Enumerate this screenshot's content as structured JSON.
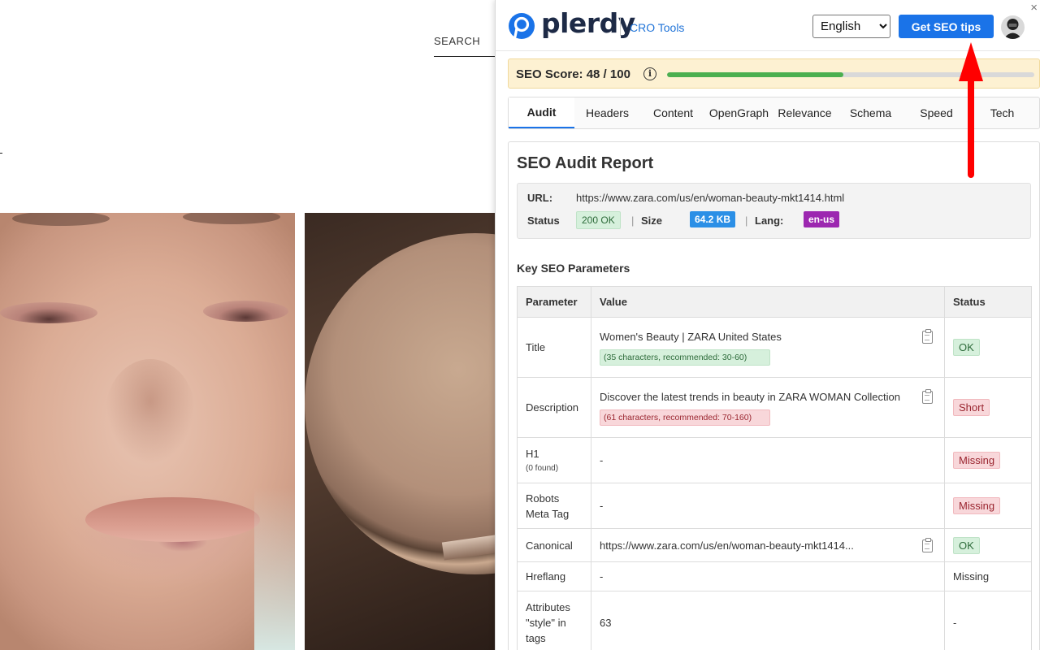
{
  "background_page": {
    "search_label": "SEARCH"
  },
  "panel": {
    "close_glyph": "×",
    "brand": "plerdy",
    "product": "CRO Tools",
    "language": {
      "selected": "English",
      "options": [
        "English"
      ]
    },
    "seo_tips_button": "Get SEO tips"
  },
  "score": {
    "label": "SEO Score: 48 / 100",
    "info_glyph": "i",
    "value": 48,
    "max": 100,
    "fill_color": "#4caf50"
  },
  "tabs": [
    {
      "label": "Audit",
      "active": true
    },
    {
      "label": "Headers",
      "active": false
    },
    {
      "label": "Content",
      "active": false
    },
    {
      "label": "OpenGraph",
      "active": false
    },
    {
      "label": "Relevance",
      "active": false
    },
    {
      "label": "Schema",
      "active": false
    },
    {
      "label": "Speed",
      "active": false
    },
    {
      "label": "Tech",
      "active": false
    }
  ],
  "report": {
    "title": "SEO Audit Report",
    "url_label": "URL:",
    "url": "https://www.zara.com/us/en/woman-beauty-mkt1414.html",
    "status_label": "Status",
    "status": "200 OK",
    "size_label": "Size",
    "size": "64.2 KB",
    "lang_label": "Lang:",
    "lang": "en-us",
    "separator": "|"
  },
  "params": {
    "title": "Key SEO Parameters",
    "headers": {
      "parameter": "Parameter",
      "value": "Value",
      "status": "Status"
    },
    "rows": [
      {
        "param": "Title",
        "value": "Women's Beauty | ZARA United States",
        "hint": "(35 characters, recommended: 30-60)",
        "status": "OK"
      },
      {
        "param": "Description",
        "value": "Discover the latest trends in beauty in ZARA WOMAN Collection",
        "hint": "(61 characters, recommended: 70-160)",
        "status": "Short"
      },
      {
        "param": "H1",
        "note": "(0 found)",
        "value": "-",
        "status": "Missing"
      },
      {
        "param": "Robots Meta Tag",
        "value": "-",
        "status": "Missing"
      },
      {
        "param": "Canonical",
        "value": "https://www.zara.com/us/en/woman-beauty-mkt1414...",
        "status": "OK"
      },
      {
        "param": "Hreflang",
        "value": "-",
        "status": "Missing"
      },
      {
        "param": "Attributes \"style\" in tags",
        "value": "63",
        "status": "-"
      }
    ]
  },
  "colors": {
    "accent_blue": "#1a73e8",
    "brand_navy": "#1d2a46",
    "score_bg": "#fdf1d2",
    "ok_bg": "#d6f0dc",
    "bad_bg": "#f8d7da",
    "size_pill": "#2b8fe6",
    "lang_pill": "#9c27b0",
    "annotation_red": "#ff0000"
  }
}
